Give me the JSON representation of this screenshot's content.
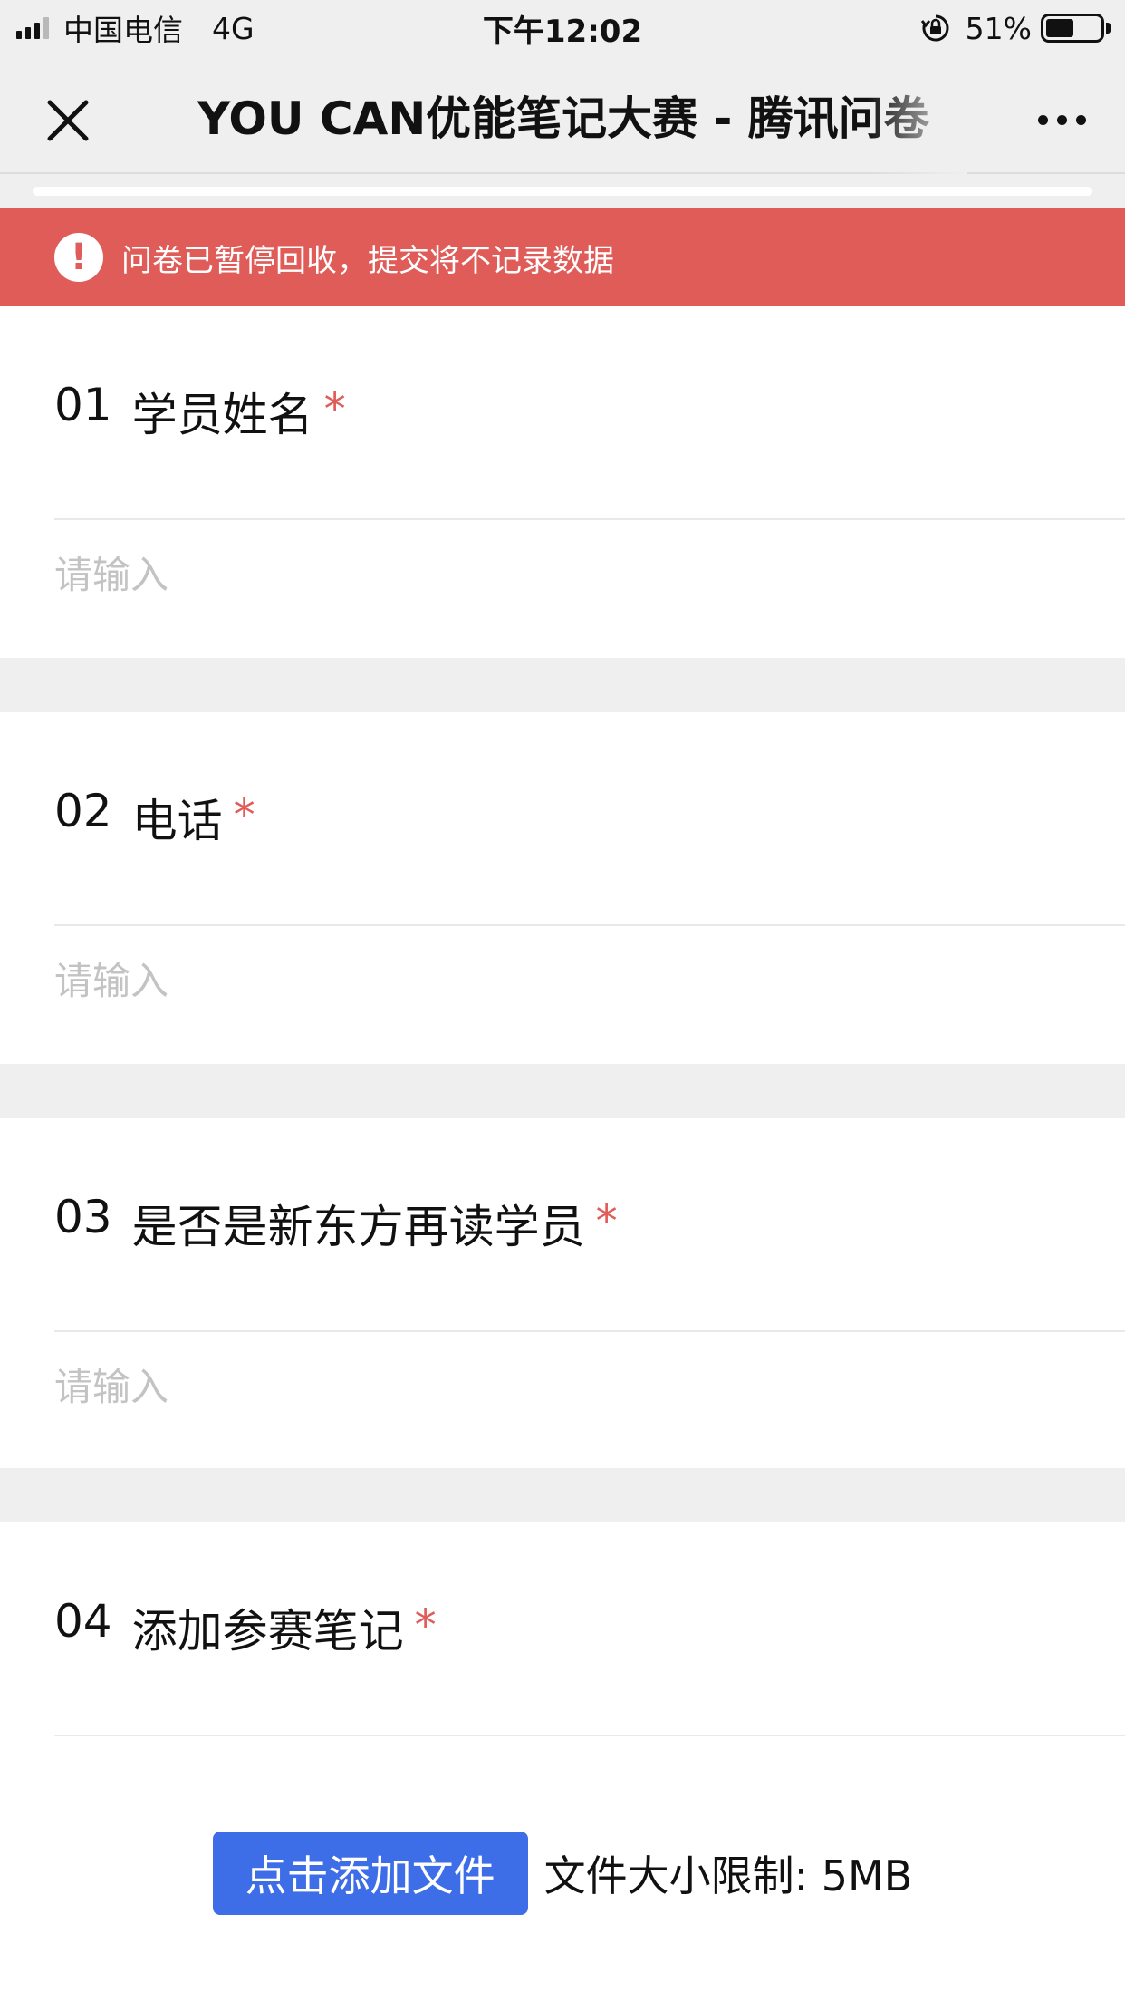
{
  "status_bar": {
    "carrier": "中国电信",
    "network": "4G",
    "time": "下午12:02",
    "battery_percent": "51%",
    "battery_level": 0.51
  },
  "nav": {
    "title": "YOU CAN优能笔记大赛 - 腾讯问卷"
  },
  "banner": {
    "text": "问卷已暂停回收，提交将不记录数据"
  },
  "questions": [
    {
      "number": "01",
      "label": "学员姓名",
      "required_mark": "*",
      "placeholder": "请输入"
    },
    {
      "number": "02",
      "label": "电话",
      "required_mark": "*",
      "placeholder": "请输入"
    },
    {
      "number": "03",
      "label": "是否是新东方再读学员",
      "required_mark": "*",
      "placeholder": "请输入"
    },
    {
      "number": "04",
      "label": "添加参赛笔记",
      "required_mark": "*"
    }
  ],
  "upload": {
    "button_label": "点击添加文件",
    "limit_text": "文件大小限制: 5MB"
  },
  "colors": {
    "accent_blue": "#3e6de8",
    "banner_red": "#e05c58",
    "required_red": "#e05c58"
  }
}
